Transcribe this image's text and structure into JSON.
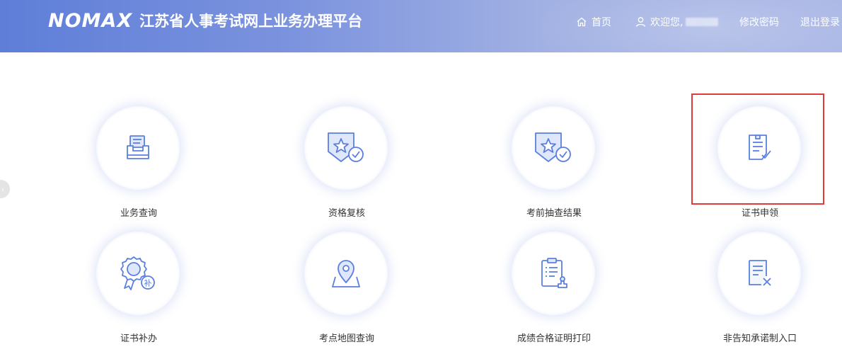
{
  "header": {
    "logo_mark": "NOMAX",
    "title": "江苏省人事考试网上业务办理平台",
    "nav": {
      "home": "首页",
      "welcome": "欢迎您,",
      "change_password": "修改密码",
      "logout": "退出登录"
    }
  },
  "tiles": [
    {
      "label": "业务查询",
      "icon": "inbox-tray-icon"
    },
    {
      "label": "资格复核",
      "icon": "star-shield-check-icon"
    },
    {
      "label": "考前抽查结果",
      "icon": "star-shield-check-icon"
    },
    {
      "label": "证书申领",
      "icon": "document-check-icon"
    },
    {
      "label": "证书补办",
      "icon": "badge-supplement-icon"
    },
    {
      "label": "考点地图查询",
      "icon": "map-pin-icon"
    },
    {
      "label": "成绩合格证明打印",
      "icon": "clipboard-stamp-icon"
    },
    {
      "label": "非告知承诺制入口",
      "icon": "document-x-icon"
    }
  ],
  "colors": {
    "accent": "#5b7fe0",
    "highlight": "#e03a3a"
  }
}
